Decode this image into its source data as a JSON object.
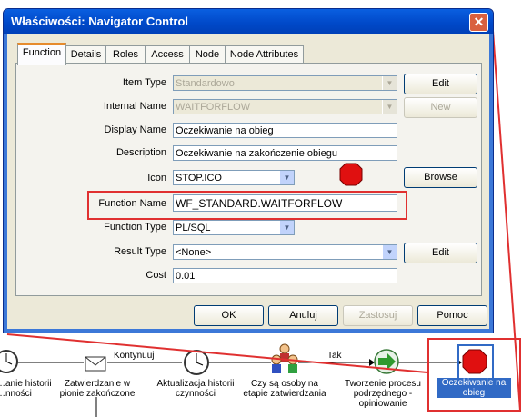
{
  "window": {
    "title": "Właściwości: Navigator Control",
    "close_glyph": "✕"
  },
  "tabs": [
    {
      "label": "Function",
      "active": true
    },
    {
      "label": "Details"
    },
    {
      "label": "Roles"
    },
    {
      "label": "Access"
    },
    {
      "label": "Node"
    },
    {
      "label": "Node Attributes"
    }
  ],
  "form": {
    "item_type": {
      "label": "Item Type",
      "value": "Standardowo"
    },
    "internal_name": {
      "label": "Internal Name",
      "value": "WAITFORFLOW"
    },
    "display_name": {
      "label": "Display Name",
      "value": "Oczekiwanie na obieg"
    },
    "description": {
      "label": "Description",
      "value": "Oczekiwanie na zakończenie obiegu"
    },
    "icon": {
      "label": "Icon",
      "value": "STOP.ICO",
      "preview": "stop-sign-icon"
    },
    "function_name": {
      "label": "Function Name",
      "value": "WF_STANDARD.WAITFORFLOW"
    },
    "function_type": {
      "label": "Function Type",
      "value": "PL/SQL"
    },
    "result_type": {
      "label": "Result Type",
      "value": "<None>"
    },
    "cost": {
      "label": "Cost",
      "value": "0.01"
    }
  },
  "side_buttons": {
    "edit1": "Edit",
    "new": "New",
    "browse": "Browse",
    "edit2": "Edit"
  },
  "footer_buttons": {
    "ok": "OK",
    "cancel": "Anuluj",
    "apply": "Zastosuj",
    "help": "Pomoc"
  },
  "workflow": {
    "nodes": [
      {
        "label": "…anie historii\n…nności"
      },
      {
        "label": "Zatwierdzanie w\npionie zakończone"
      },
      {
        "label": "Aktualizacja historii\nczynności"
      },
      {
        "label": "Czy są osoby na\netapie zatwierdzania"
      },
      {
        "label": "Tworzenie procesu\npodrzędnego -\nopiniowanie"
      },
      {
        "label": "Oczekiwanie na\nobieg",
        "selected": true
      }
    ],
    "edges": [
      {
        "label": "Kontynuuj"
      },
      {
        "label": "Tak"
      }
    ]
  },
  "colors": {
    "highlight": "#e03030",
    "titlebar": "#0a5fe0",
    "selection": "#316ac5"
  }
}
